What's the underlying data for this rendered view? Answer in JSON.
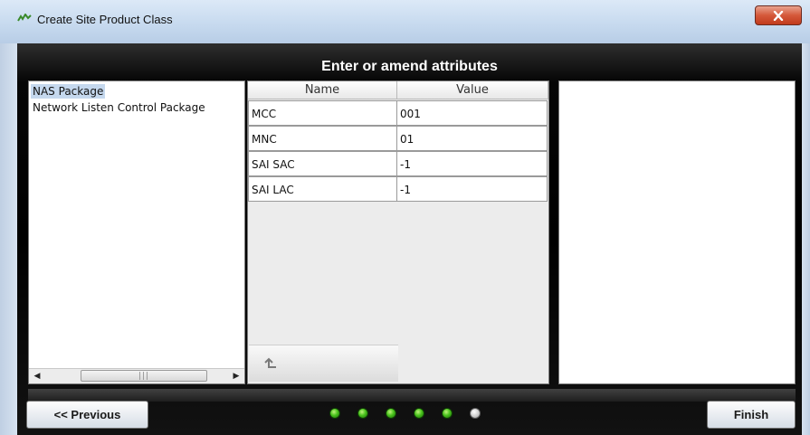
{
  "window": {
    "title": "Create Site Product Class",
    "icon": "java-app-icon",
    "close_icon": "close-icon"
  },
  "header": {
    "title": "Enter or amend attributes"
  },
  "packages": {
    "items": [
      {
        "label": "NAS Package",
        "selected": true
      },
      {
        "label": "Network Listen Control Package",
        "selected": false
      }
    ]
  },
  "attributes": {
    "columns": [
      "Name",
      "Value"
    ],
    "rows": [
      {
        "name": "MCC",
        "value": "001"
      },
      {
        "name": "MNC",
        "value": "01"
      },
      {
        "name": "SAI SAC",
        "value": "-1"
      },
      {
        "name": "SAI LAC",
        "value": "-1"
      }
    ],
    "move_up_icon": "move-up-icon"
  },
  "footer": {
    "previous_label": "<< Previous",
    "finish_label": "Finish",
    "steps_total": 6,
    "current_step": 6,
    "step_colors": {
      "done": "#3cbf1a",
      "current": "#c8c8c8"
    }
  }
}
